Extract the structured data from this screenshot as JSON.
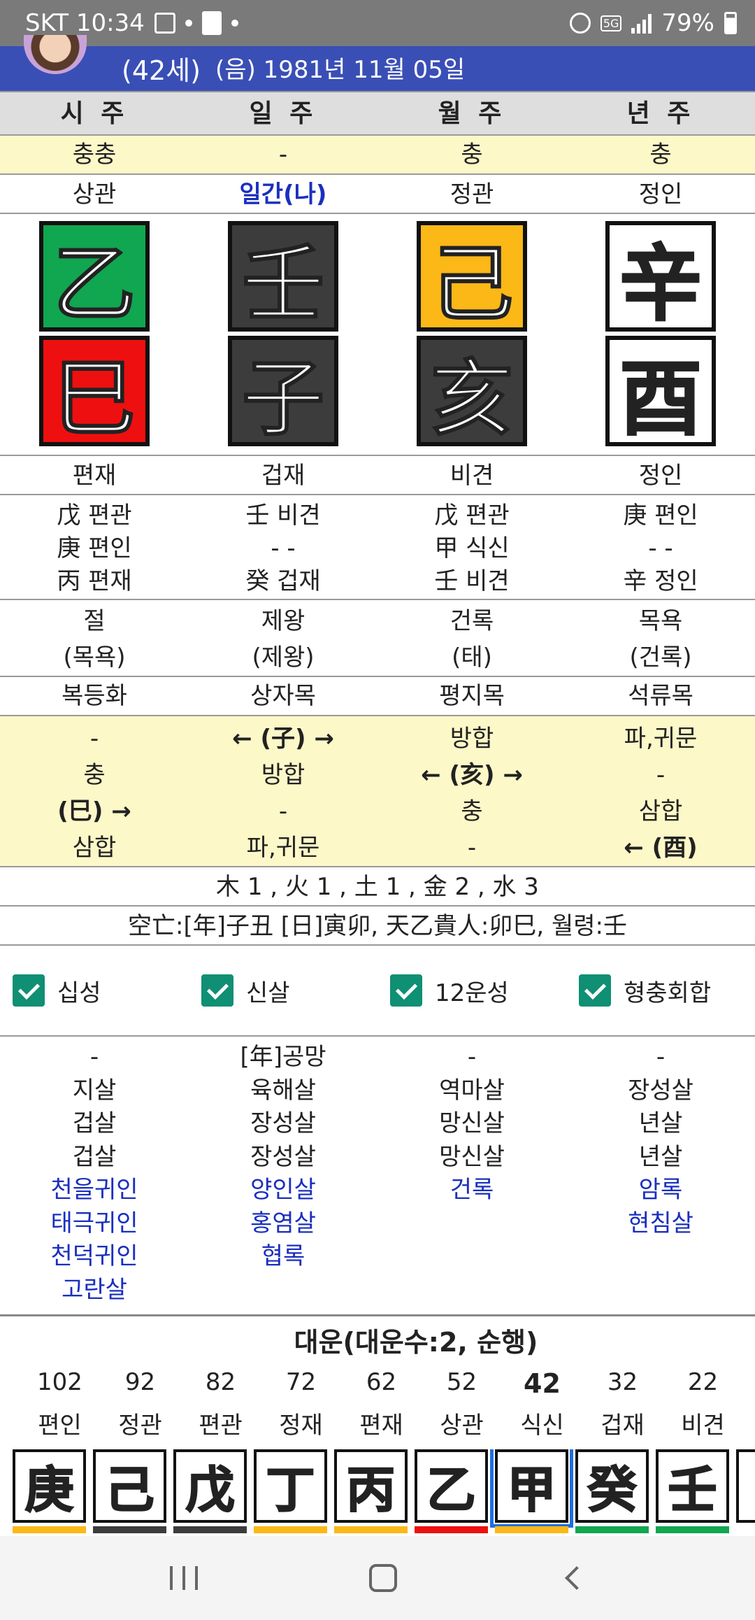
{
  "status": {
    "time": "SKT 10:34",
    "network": "5G",
    "battery": "79%"
  },
  "header": {
    "age": "(42세)",
    "dob": "(음) 1981년 11월 05일"
  },
  "columns": [
    "시 주",
    "일 주",
    "월 주",
    "년 주"
  ],
  "clash_row": [
    "충충",
    "-",
    "충",
    "충"
  ],
  "god_row": [
    "상관",
    "일간(나)",
    "정관",
    "정인"
  ],
  "stems": [
    "乙",
    "壬",
    "己",
    "辛"
  ],
  "branches": [
    "巳",
    "子",
    "亥",
    "酉"
  ],
  "branch_gods": [
    "편재",
    "겁재",
    "비견",
    "정인"
  ],
  "hidden": [
    [
      "戊 편관",
      "庚 편인",
      "丙 편재"
    ],
    [
      "壬 비견",
      "- -",
      "癸 겁재"
    ],
    [
      "戊 편관",
      "甲 식신",
      "壬 비견"
    ],
    [
      "庚 편인",
      "- -",
      "辛 정인"
    ]
  ],
  "stage": [
    [
      "절",
      "(목욕)"
    ],
    [
      "제왕",
      "(제왕)"
    ],
    [
      "건록",
      "(태)"
    ],
    [
      "목욕",
      "(건록)"
    ]
  ],
  "nayin": [
    "복등화",
    "상자목",
    "평지목",
    "석류목"
  ],
  "relations": [
    [
      "-",
      "충",
      "(巳) →",
      "삼합"
    ],
    [
      "← (子) →",
      "방합",
      "-",
      "파,귀문"
    ],
    [
      "방합",
      "← (亥) →",
      "충",
      "-"
    ],
    [
      "파,귀문",
      "-",
      "삼합",
      "← (酉)"
    ]
  ],
  "elements": "木 1 , 火 1 , 土 1 , 金 2 , 水 3",
  "gongmang": "空亡:[年]子丑 [日]寅卯, 天乙貴人:卯巳, 월령:壬",
  "checks": [
    "십성",
    "신살",
    "12운성",
    "형충회합"
  ],
  "sinsal": [
    {
      "black": [
        "-",
        "지살",
        "겁살",
        "겁살"
      ],
      "blue": [
        "천을귀인",
        "태극귀인",
        "천덕귀인",
        "고란살"
      ]
    },
    {
      "black": [
        "[年]공망",
        "육해살",
        "장성살",
        "장성살"
      ],
      "blue": [
        "양인살",
        "홍염살",
        "협록"
      ]
    },
    {
      "black": [
        "-",
        "역마살",
        "망신살",
        "망신살"
      ],
      "blue": [
        "건록"
      ]
    },
    {
      "black": [
        "-",
        "장성살",
        "년살",
        "년살"
      ],
      "blue": [
        "암록",
        "현침살"
      ]
    }
  ],
  "daewoon": {
    "title": "대운(대운수:2, 순행)",
    "ages": [
      "102",
      "92",
      "82",
      "72",
      "62",
      "52",
      "42",
      "32",
      "22"
    ],
    "gods": [
      "편인",
      "정관",
      "편관",
      "정재",
      "편재",
      "상관",
      "식신",
      "겁재",
      "비견"
    ],
    "stems": [
      "庚",
      "己",
      "戊",
      "丁",
      "丙",
      "乙",
      "甲",
      "癸",
      "壬"
    ],
    "current_age": "42"
  }
}
